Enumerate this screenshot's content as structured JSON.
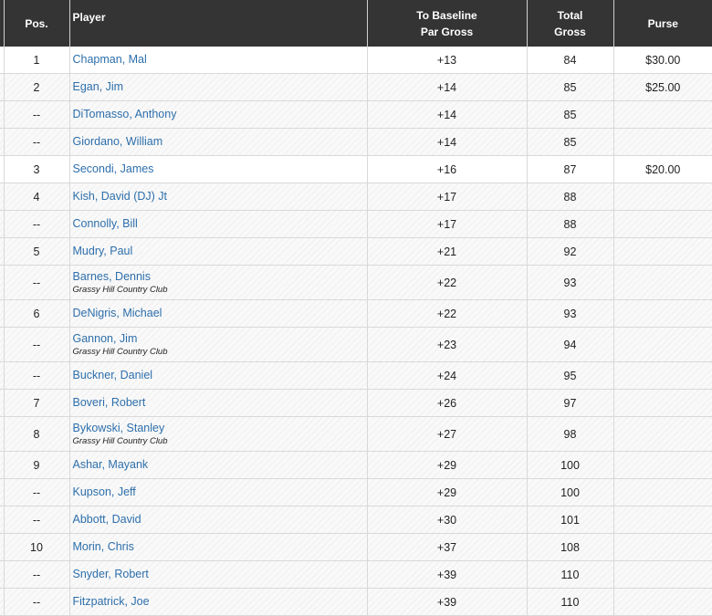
{
  "header": {
    "pos": "Pos.",
    "player": "Player",
    "baseline_line1": "To Baseline",
    "baseline_line2": "Par Gross",
    "total_line1": "Total",
    "total_line2": "Gross",
    "purse": "Purse"
  },
  "rows": [
    {
      "pos": "1",
      "player": "Chapman, Mal",
      "club": "",
      "baseline": "+13",
      "total": "84",
      "purse": "$30.00"
    },
    {
      "pos": "2",
      "player": "Egan, Jim",
      "club": "",
      "baseline": "+14",
      "total": "85",
      "purse": "$25.00"
    },
    {
      "pos": "--",
      "player": "DiTomasso, Anthony",
      "club": "",
      "baseline": "+14",
      "total": "85",
      "purse": ""
    },
    {
      "pos": "--",
      "player": "Giordano, William",
      "club": "",
      "baseline": "+14",
      "total": "85",
      "purse": ""
    },
    {
      "pos": "3",
      "player": "Secondi, James",
      "club": "",
      "baseline": "+16",
      "total": "87",
      "purse": "$20.00"
    },
    {
      "pos": "4",
      "player": "Kish, David (DJ) Jt",
      "club": "",
      "baseline": "+17",
      "total": "88",
      "purse": ""
    },
    {
      "pos": "--",
      "player": "Connolly, Bill",
      "club": "",
      "baseline": "+17",
      "total": "88",
      "purse": ""
    },
    {
      "pos": "5",
      "player": "Mudry, Paul",
      "club": "",
      "baseline": "+21",
      "total": "92",
      "purse": ""
    },
    {
      "pos": "--",
      "player": "Barnes, Dennis",
      "club": "Grassy Hill Country Club",
      "baseline": "+22",
      "total": "93",
      "purse": ""
    },
    {
      "pos": "6",
      "player": "DeNigris, Michael",
      "club": "",
      "baseline": "+22",
      "total": "93",
      "purse": ""
    },
    {
      "pos": "--",
      "player": "Gannon, Jim",
      "club": "Grassy Hill Country Club",
      "baseline": "+23",
      "total": "94",
      "purse": ""
    },
    {
      "pos": "--",
      "player": "Buckner, Daniel",
      "club": "",
      "baseline": "+24",
      "total": "95",
      "purse": ""
    },
    {
      "pos": "7",
      "player": "Boveri, Robert",
      "club": "",
      "baseline": "+26",
      "total": "97",
      "purse": ""
    },
    {
      "pos": "8",
      "player": "Bykowski, Stanley",
      "club": "Grassy Hill Country Club",
      "baseline": "+27",
      "total": "98",
      "purse": ""
    },
    {
      "pos": "9",
      "player": "Ashar, Mayank",
      "club": "",
      "baseline": "+29",
      "total": "100",
      "purse": ""
    },
    {
      "pos": "--",
      "player": "Kupson, Jeff",
      "club": "",
      "baseline": "+29",
      "total": "100",
      "purse": ""
    },
    {
      "pos": "--",
      "player": "Abbott, David",
      "club": "",
      "baseline": "+30",
      "total": "101",
      "purse": ""
    },
    {
      "pos": "10",
      "player": "Morin, Chris",
      "club": "",
      "baseline": "+37",
      "total": "108",
      "purse": ""
    },
    {
      "pos": "--",
      "player": "Snyder, Robert",
      "club": "",
      "baseline": "+39",
      "total": "110",
      "purse": ""
    },
    {
      "pos": "--",
      "player": "Fitzpatrick, Joe",
      "club": "",
      "baseline": "+39",
      "total": "110",
      "purse": ""
    }
  ],
  "colors": {
    "header_bg": "#343434",
    "link": "#2d6fab"
  }
}
